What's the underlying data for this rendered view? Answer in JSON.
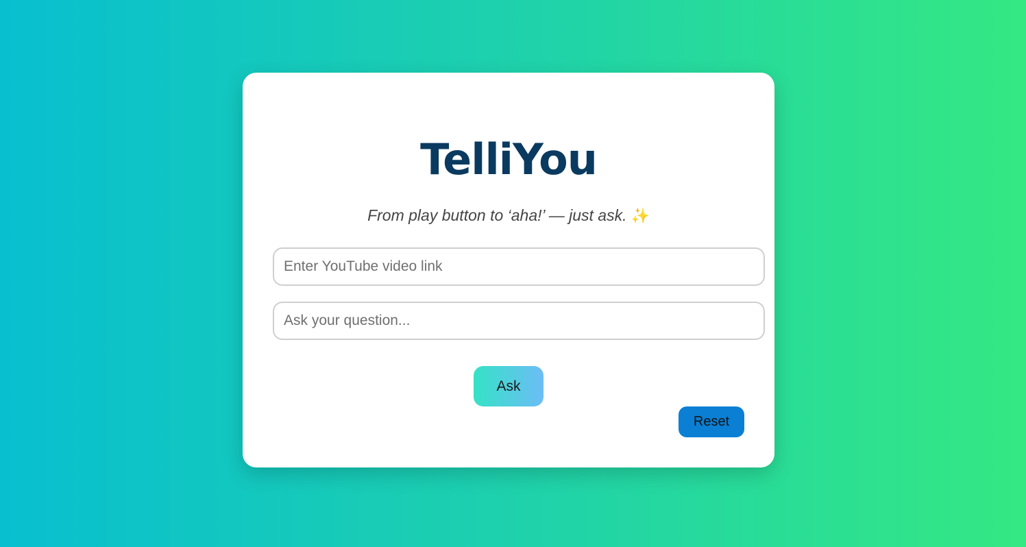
{
  "app": {
    "title": "TelliYou",
    "tagline": "From play button to ‘aha!’ — just ask.",
    "tagline_icon": "sparkles-icon"
  },
  "form": {
    "video_link_placeholder": "Enter YouTube video link",
    "video_link_value": "",
    "question_placeholder": "Ask your question...",
    "question_value": "",
    "ask_label": "Ask",
    "reset_label": "Reset"
  },
  "colors": {
    "background_start": "#08bfd0",
    "background_end": "#34e883",
    "title": "#0a3a5f",
    "ask_gradient_start": "#35e2c6",
    "ask_gradient_end": "#6cbdf6",
    "reset": "#0a7fd4"
  }
}
